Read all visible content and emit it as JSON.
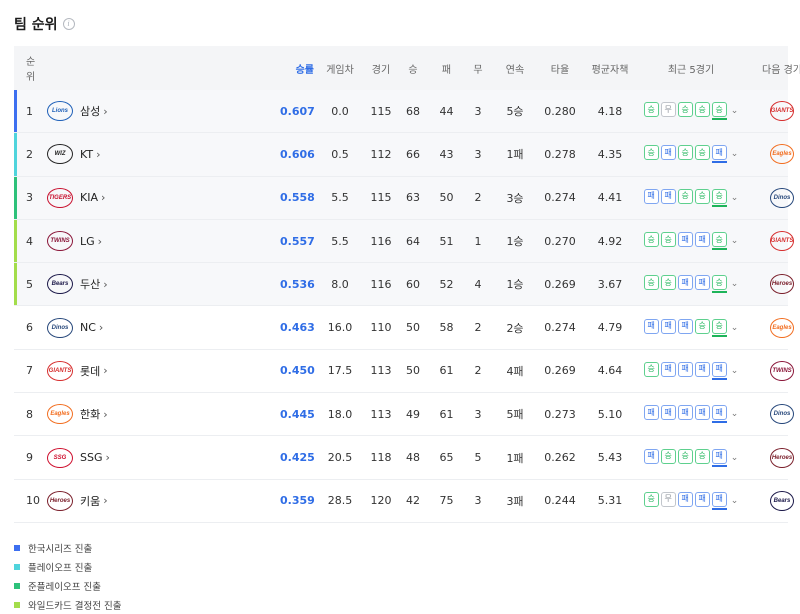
{
  "page": {
    "title": "팀 순위",
    "info_icon": "i"
  },
  "headers": {
    "rank": "순위",
    "pct": "승률",
    "gb": "게임차",
    "games": "경기",
    "wins": "승",
    "losses": "패",
    "draws": "무",
    "streak": "연속",
    "avg": "타율",
    "era": "평균자책",
    "last5": "최근 5경기",
    "next": "다음 경기"
  },
  "colors": {
    "korean_series": "#3d6ff0",
    "playoff": "#4fd4dc",
    "semi_playoff": "#2dc17a",
    "wildcard": "#a3dd4b",
    "win": "#1eb45a",
    "loss": "#2f6de6",
    "draw": "#8a8f97"
  },
  "rows": [
    {
      "rank": "1",
      "team": "삼성",
      "logo_icon": "lions-logo-icon",
      "logo_text": "Lions",
      "logo_color": "#1d5fb8",
      "pct": "0.607",
      "gb": "0.0",
      "games": "115",
      "wins": "68",
      "losses": "44",
      "draws": "3",
      "streak": "5승",
      "avg": "0.280",
      "era": "4.18",
      "last5": [
        "승",
        "무",
        "승",
        "승",
        "승"
      ],
      "next_icon": "giants-logo-icon",
      "next_text": "GIANTS",
      "next_color": "#d62d2d",
      "stripe": "korean_series"
    },
    {
      "rank": "2",
      "team": "KT",
      "logo_icon": "wiz-logo-icon",
      "logo_text": "WIZ",
      "logo_color": "#222222",
      "pct": "0.606",
      "gb": "0.5",
      "games": "112",
      "wins": "66",
      "losses": "43",
      "draws": "3",
      "streak": "1패",
      "avg": "0.278",
      "era": "4.35",
      "last5": [
        "승",
        "패",
        "승",
        "승",
        "패"
      ],
      "next_icon": "eagles-logo-icon",
      "next_text": "Eagles",
      "next_color": "#f26d1f",
      "stripe": "playoff"
    },
    {
      "rank": "3",
      "team": "KIA",
      "logo_icon": "tigers-logo-icon",
      "logo_text": "TIGERS",
      "logo_color": "#c8102e",
      "pct": "0.558",
      "gb": "5.5",
      "games": "115",
      "wins": "63",
      "losses": "50",
      "draws": "2",
      "streak": "3승",
      "avg": "0.274",
      "era": "4.41",
      "last5": [
        "패",
        "패",
        "승",
        "승",
        "승"
      ],
      "next_icon": "dinos-logo-icon",
      "next_text": "Dinos",
      "next_color": "#25467a",
      "stripe": "semi_playoff"
    },
    {
      "rank": "4",
      "team": "LG",
      "logo_icon": "twins-logo-icon",
      "logo_text": "TWINS",
      "logo_color": "#8a1538",
      "pct": "0.557",
      "gb": "5.5",
      "games": "116",
      "wins": "64",
      "losses": "51",
      "draws": "1",
      "streak": "1승",
      "avg": "0.270",
      "era": "4.92",
      "last5": [
        "승",
        "승",
        "패",
        "패",
        "승"
      ],
      "next_icon": "giants-logo-icon",
      "next_text": "GIANTS",
      "next_color": "#d62d2d",
      "stripe": "wildcard"
    },
    {
      "rank": "5",
      "team": "두산",
      "logo_icon": "bears-logo-icon",
      "logo_text": "Bears",
      "logo_color": "#1a1748",
      "pct": "0.536",
      "gb": "8.0",
      "games": "116",
      "wins": "60",
      "losses": "52",
      "draws": "4",
      "streak": "1승",
      "avg": "0.269",
      "era": "3.67",
      "last5": [
        "승",
        "승",
        "패",
        "패",
        "승"
      ],
      "next_icon": "heroes-logo-icon",
      "next_text": "Heroes",
      "next_color": "#7a1e2a",
      "stripe": "wildcard"
    },
    {
      "rank": "6",
      "team": "NC",
      "logo_icon": "dinos-logo-icon",
      "logo_text": "Dinos",
      "logo_color": "#25467a",
      "pct": "0.463",
      "gb": "16.0",
      "games": "110",
      "wins": "50",
      "losses": "58",
      "draws": "2",
      "streak": "2승",
      "avg": "0.274",
      "era": "4.79",
      "last5": [
        "패",
        "패",
        "패",
        "승",
        "승"
      ],
      "next_icon": "eagles-logo-icon",
      "next_text": "Eagles",
      "next_color": "#f26d1f",
      "stripe": ""
    },
    {
      "rank": "7",
      "team": "롯데",
      "logo_icon": "giants-logo-icon",
      "logo_text": "GIANTS",
      "logo_color": "#d62d2d",
      "pct": "0.450",
      "gb": "17.5",
      "games": "113",
      "wins": "50",
      "losses": "61",
      "draws": "2",
      "streak": "4패",
      "avg": "0.269",
      "era": "4.64",
      "last5": [
        "승",
        "패",
        "패",
        "패",
        "패"
      ],
      "next_icon": "twins-logo-icon",
      "next_text": "TWINS",
      "next_color": "#8a1538",
      "stripe": ""
    },
    {
      "rank": "8",
      "team": "한화",
      "logo_icon": "eagles-logo-icon",
      "logo_text": "Eagles",
      "logo_color": "#f26d1f",
      "pct": "0.445",
      "gb": "18.0",
      "games": "113",
      "wins": "49",
      "losses": "61",
      "draws": "3",
      "streak": "5패",
      "avg": "0.273",
      "era": "5.10",
      "last5": [
        "패",
        "패",
        "패",
        "패",
        "패"
      ],
      "next_icon": "dinos-logo-icon",
      "next_text": "Dinos",
      "next_color": "#25467a",
      "stripe": ""
    },
    {
      "rank": "9",
      "team": "SSG",
      "logo_icon": "landers-logo-icon",
      "logo_text": "SSG",
      "logo_color": "#ce0e2d",
      "pct": "0.425",
      "gb": "20.5",
      "games": "118",
      "wins": "48",
      "losses": "65",
      "draws": "5",
      "streak": "1패",
      "avg": "0.262",
      "era": "5.43",
      "last5": [
        "패",
        "승",
        "승",
        "승",
        "패"
      ],
      "next_icon": "heroes-logo-icon",
      "next_text": "Heroes",
      "next_color": "#7a1e2a",
      "stripe": ""
    },
    {
      "rank": "10",
      "team": "키움",
      "logo_icon": "heroes-logo-icon",
      "logo_text": "Heroes",
      "logo_color": "#7a1e2a",
      "pct": "0.359",
      "gb": "28.5",
      "games": "120",
      "wins": "42",
      "losses": "75",
      "draws": "3",
      "streak": "3패",
      "avg": "0.244",
      "era": "5.31",
      "last5": [
        "승",
        "무",
        "패",
        "패",
        "패"
      ],
      "next_icon": "bears-logo-icon",
      "next_text": "Bears",
      "next_color": "#1a1748",
      "stripe": ""
    }
  ],
  "legend": [
    {
      "label": "한국시리즈 진출",
      "color_key": "korean_series"
    },
    {
      "label": "플레이오프 진출",
      "color_key": "playoff"
    },
    {
      "label": "준플레이오프 진출",
      "color_key": "semi_playoff"
    },
    {
      "label": "와일드카드 결정전 진출",
      "color_key": "wildcard"
    }
  ]
}
